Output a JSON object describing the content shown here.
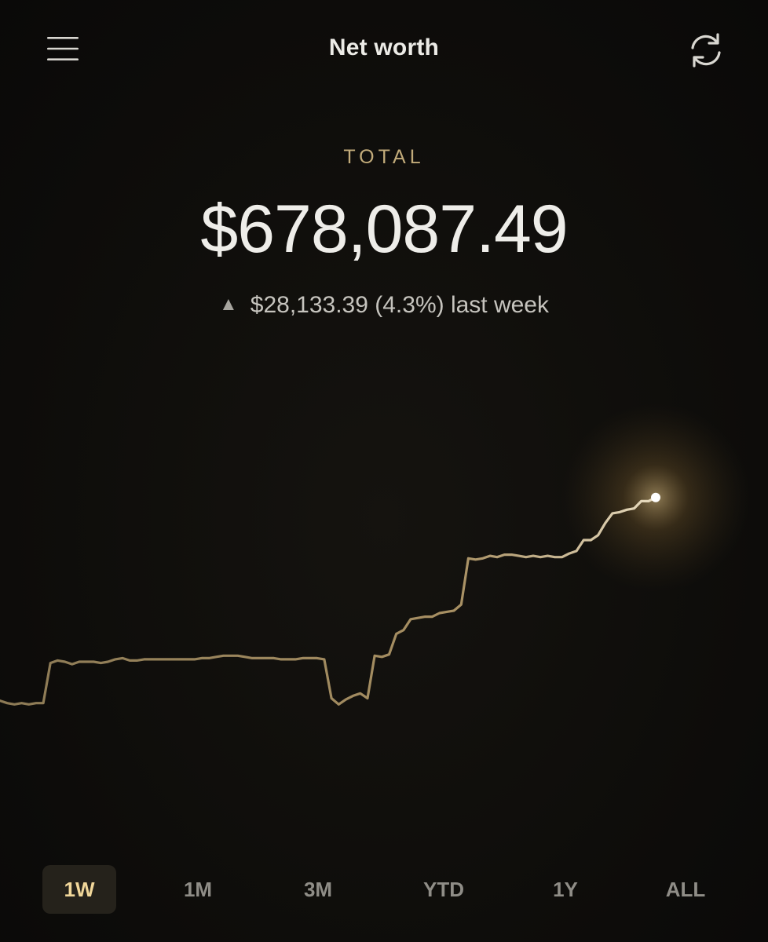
{
  "header": {
    "title": "Net worth",
    "menu_icon": "hamburger-menu-icon",
    "refresh_icon": "refresh-icon"
  },
  "summary": {
    "label": "TOTAL",
    "amount": "$678,087.49",
    "change_arrow": "▲",
    "change_text": "$28,133.39 (4.3%) last week"
  },
  "ranges": [
    {
      "label": "1W",
      "active": true
    },
    {
      "label": "1M",
      "active": false
    },
    {
      "label": "3M",
      "active": false
    },
    {
      "label": "YTD",
      "active": false
    },
    {
      "label": "1Y",
      "active": false
    },
    {
      "label": "ALL",
      "active": false
    }
  ],
  "colors": {
    "accent": "#c2ab7a",
    "line": "#a08a5a",
    "active_range_text": "#f1d79a",
    "background": "#0d0c0a"
  },
  "chart_data": {
    "type": "line",
    "x": [
      0,
      1,
      2,
      3,
      4,
      5,
      6,
      7,
      8,
      9,
      10,
      11,
      12,
      13,
      14,
      15,
      16,
      17,
      18,
      19,
      20,
      21,
      22,
      23,
      24,
      25,
      26,
      27,
      28,
      29,
      30,
      31,
      32,
      33,
      34,
      35,
      36,
      37,
      38,
      39,
      40,
      41,
      42,
      43,
      44,
      45,
      46,
      47,
      48,
      49,
      50,
      51,
      52,
      53,
      54,
      55,
      56,
      57,
      58,
      59,
      60,
      61,
      62,
      63,
      64,
      65,
      66,
      67,
      68,
      69,
      70,
      71,
      72,
      73,
      74,
      75,
      76,
      77,
      78,
      79,
      80,
      81,
      82,
      83,
      84,
      85,
      86,
      87,
      88,
      89,
      90,
      91,
      92,
      93,
      94,
      95,
      96,
      97,
      98,
      99
    ],
    "values": [
      650.8,
      650.6,
      650.5,
      650.6,
      650.5,
      650.6,
      650.6,
      653.9,
      654.1,
      654.0,
      653.8,
      654.0,
      654.0,
      654.0,
      653.9,
      654.0,
      654.2,
      654.3,
      654.1,
      654.1,
      654.2,
      654.2,
      654.2,
      654.2,
      654.2,
      654.2,
      654.2,
      654.2,
      654.3,
      654.3,
      654.4,
      654.5,
      654.5,
      654.5,
      654.4,
      654.3,
      654.3,
      654.3,
      654.3,
      654.2,
      654.2,
      654.2,
      654.3,
      654.3,
      654.3,
      654.2,
      651.0,
      650.5,
      650.9,
      651.2,
      651.4,
      651.0,
      654.5,
      654.4,
      654.6,
      656.3,
      656.6,
      657.5,
      657.6,
      657.7,
      657.7,
      658.0,
      658.1,
      658.2,
      658.7,
      662.5,
      662.4,
      662.5,
      662.7,
      662.6,
      662.8,
      662.8,
      662.7,
      662.6,
      662.7,
      662.6,
      662.7,
      662.6,
      662.6,
      662.9,
      663.1,
      664.0,
      664.0,
      664.4,
      665.4,
      666.2,
      666.3,
      666.5,
      666.6,
      667.2,
      667.2,
      667.5
    ],
    "xlim": [
      0,
      91
    ],
    "ylim": [
      640,
      680
    ],
    "grid": false,
    "legend": "none"
  }
}
